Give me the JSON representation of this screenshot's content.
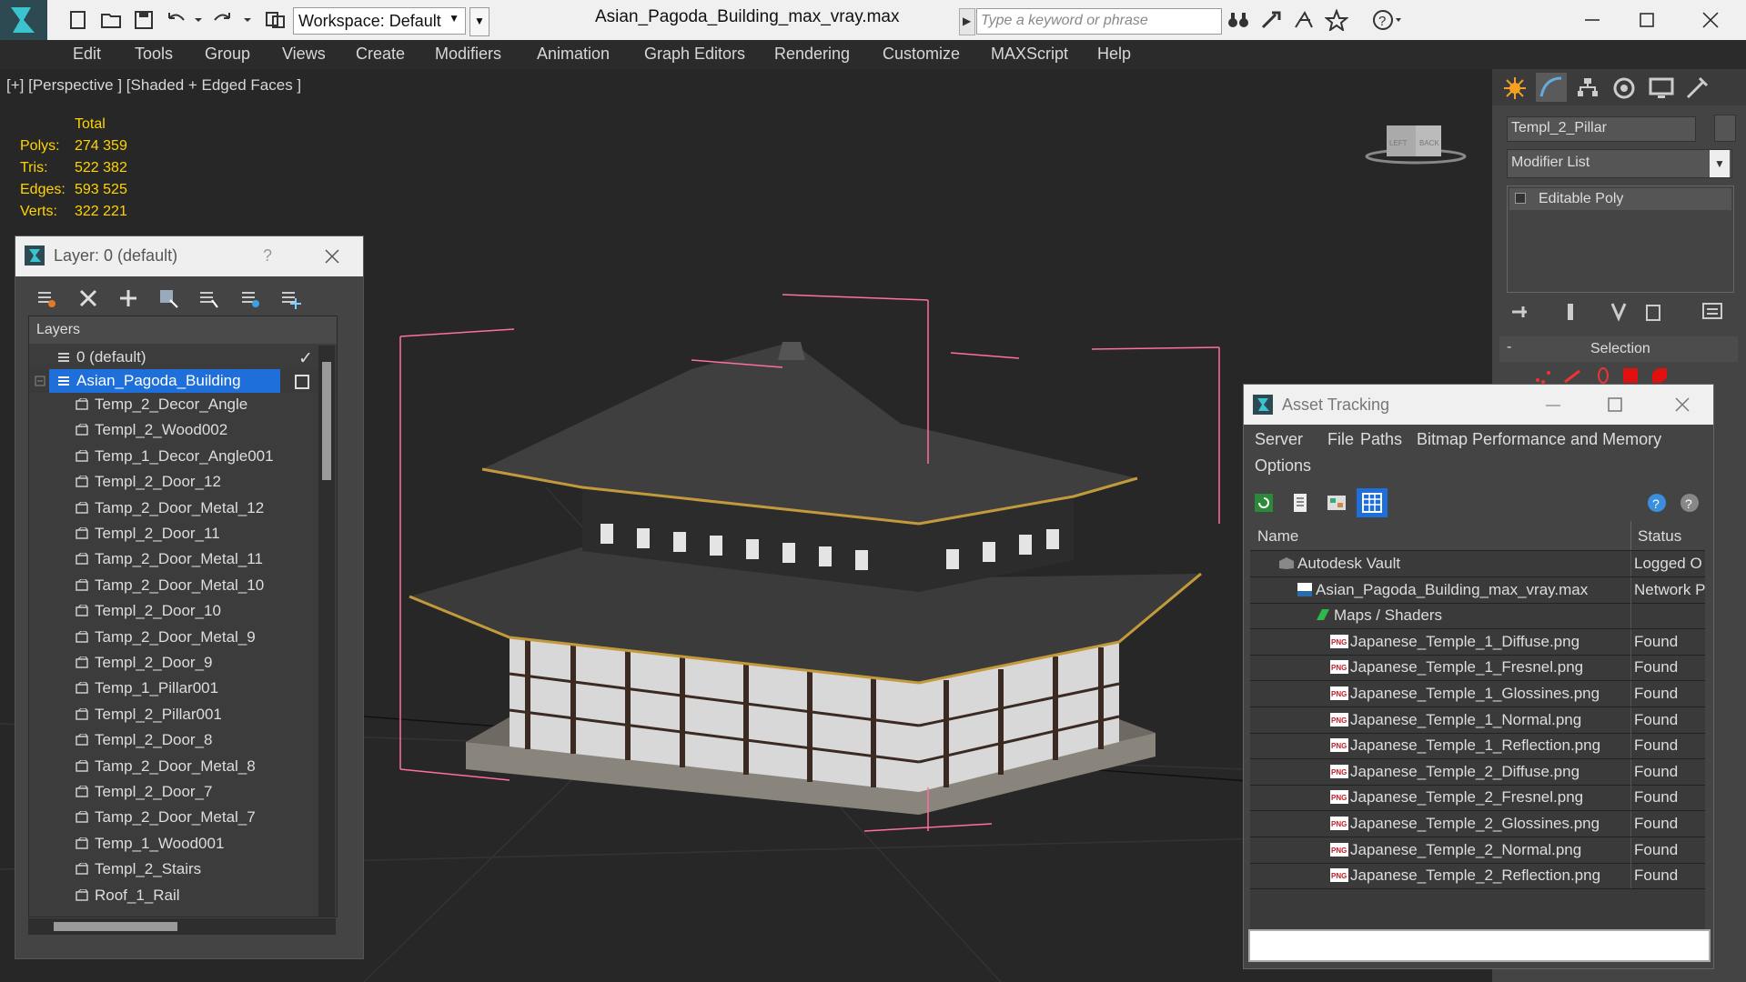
{
  "app": {
    "title": "Asian_Pagoda_Building_max_vray.max",
    "workspace": "Workspace: Default",
    "search_placeholder": "Type a keyword or phrase"
  },
  "menu": [
    "Edit",
    "Tools",
    "Group",
    "Views",
    "Create",
    "Modifiers",
    "Animation",
    "Graph Editors",
    "Rendering",
    "Customize",
    "MAXScript",
    "Help"
  ],
  "viewport": {
    "label": "[+] [Perspective ] [Shaded + Edged Faces ]",
    "stats_header": "Total",
    "stats": [
      {
        "label": "Polys:",
        "value": "274 359"
      },
      {
        "label": "Tris:",
        "value": "522 382"
      },
      {
        "label": "Edges:",
        "value": "593 525"
      },
      {
        "label": "Verts:",
        "value": "322 221"
      }
    ],
    "viewcube_left": "LEFT",
    "viewcube_back": "BACK"
  },
  "layer_dialog": {
    "title": "Layer: 0 (default)",
    "help": "?",
    "header": "Layers",
    "layers": [
      {
        "name": "0 (default)",
        "level": 0,
        "type": "layer",
        "check": "✓"
      },
      {
        "name": "Asian_Pagoda_Building",
        "level": 0,
        "type": "layer",
        "selected": true
      }
    ],
    "objects": [
      "Temp_2_Decor_Angle",
      "Templ_2_Wood002",
      "Temp_1_Decor_Angle001",
      "Templ_2_Door_12",
      "Tamp_2_Door_Metal_12",
      "Templ_2_Door_11",
      "Tamp_2_Door_Metal_11",
      "Tamp_2_Door_Metal_10",
      "Templ_2_Door_10",
      "Tamp_2_Door_Metal_9",
      "Templ_2_Door_9",
      "Temp_1_Pillar001",
      "Templ_2_Pillar001",
      "Templ_2_Door_8",
      "Tamp_2_Door_Metal_8",
      "Templ_2_Door_7",
      "Tamp_2_Door_Metal_7",
      "Temp_1_Wood001",
      "Templ_2_Stairs",
      "Roof_1_Rail"
    ]
  },
  "command_panel": {
    "object_name": "Templ_2_Pillar",
    "modifier_list": "Modifier List",
    "stack_item": "Editable Poly",
    "rollout": "Selection",
    "rollout_collapse": "-"
  },
  "asset_tracking": {
    "title": "Asset Tracking",
    "menu": [
      "Server",
      "File",
      "Paths",
      "Bitmap Performance and Memory",
      "Options"
    ],
    "columns": {
      "name": "Name",
      "status": "Status"
    },
    "rows": [
      {
        "name": "Autodesk Vault",
        "status": "Logged O",
        "indent": 0,
        "icon": "vault"
      },
      {
        "name": "Asian_Pagoda_Building_max_vray.max",
        "status": "Network P",
        "indent": 1,
        "icon": "max"
      },
      {
        "name": "Maps / Shaders",
        "status": "",
        "indent": 2,
        "icon": "maps"
      },
      {
        "name": "Japanese_Temple_1_Diffuse.png",
        "status": "Found",
        "indent": 3,
        "icon": "png"
      },
      {
        "name": "Japanese_Temple_1_Fresnel.png",
        "status": "Found",
        "indent": 3,
        "icon": "png"
      },
      {
        "name": "Japanese_Temple_1_Glossines.png",
        "status": "Found",
        "indent": 3,
        "icon": "png"
      },
      {
        "name": "Japanese_Temple_1_Normal.png",
        "status": "Found",
        "indent": 3,
        "icon": "png"
      },
      {
        "name": "Japanese_Temple_1_Reflection.png",
        "status": "Found",
        "indent": 3,
        "icon": "png"
      },
      {
        "name": "Japanese_Temple_2_Diffuse.png",
        "status": "Found",
        "indent": 3,
        "icon": "png"
      },
      {
        "name": "Japanese_Temple_2_Fresnel.png",
        "status": "Found",
        "indent": 3,
        "icon": "png"
      },
      {
        "name": "Japanese_Temple_2_Glossines.png",
        "status": "Found",
        "indent": 3,
        "icon": "png"
      },
      {
        "name": "Japanese_Temple_2_Normal.png",
        "status": "Found",
        "indent": 3,
        "icon": "png"
      },
      {
        "name": "Japanese_Temple_2_Reflection.png",
        "status": "Found",
        "indent": 3,
        "icon": "png"
      }
    ],
    "png_badge": "PNG"
  },
  "colors": {
    "accent_selected": "#1e6fd9",
    "stats_yellow": "#ffd400",
    "bbox_pink": "#ff6fa0"
  }
}
